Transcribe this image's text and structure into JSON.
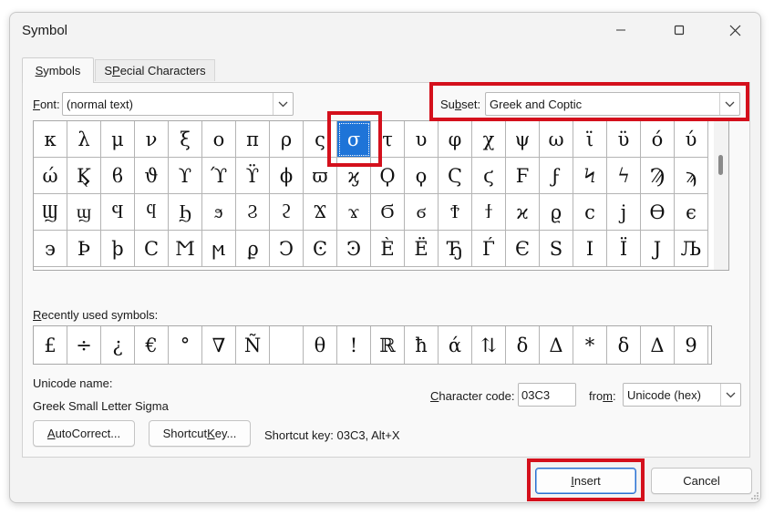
{
  "window": {
    "title": "Symbol"
  },
  "tabs": [
    {
      "label": "Symbols",
      "accel": "S",
      "rest": "ymbols"
    },
    {
      "label": "Special Characters",
      "accel": "P",
      "pre": "S",
      "rest": "ecial Characters"
    }
  ],
  "font": {
    "accel": "F",
    "rest": "ont:",
    "value": "(normal text)"
  },
  "subset": {
    "pre": "Su",
    "accel": "b",
    "rest": "set:",
    "value": "Greek and Coptic"
  },
  "symbol_grid": {
    "selected": "σ",
    "cells": [
      "κ",
      "λ",
      "μ",
      "ν",
      "ξ",
      "ο",
      "π",
      "ρ",
      "ς",
      "σ",
      "τ",
      "υ",
      "φ",
      "χ",
      "ψ",
      "ω",
      "ϊ",
      "ϋ",
      "ό",
      "ύ",
      "ώ",
      "Ϗ",
      "ϐ",
      "ϑ",
      "ϒ",
      "ϓ",
      "ϔ",
      "ϕ",
      "ϖ",
      "ϗ",
      "Ϙ",
      "ϙ",
      "Ϛ",
      "ϛ",
      "Ϝ",
      "ϝ",
      "Ϟ",
      "ϟ",
      "Ϡ",
      "ϡ",
      "Ϣ",
      "ϣ",
      "Ϥ",
      "ϥ",
      "Ϧ",
      "ϧ",
      "Ϩ",
      "ϩ",
      "Ϫ",
      "ϫ",
      "Ϭ",
      "ϭ",
      "Ϯ",
      "ϯ",
      "ϰ",
      "ϱ",
      "ϲ",
      "ϳ",
      "ϴ",
      "ϵ",
      "϶",
      "Ϸ",
      "ϸ",
      "Ϲ",
      "Ϻ",
      "ϻ",
      "ϼ",
      "Ͻ",
      "Ͼ",
      "Ͽ",
      "Ѐ",
      "Ё",
      "Ђ",
      "Ѓ",
      "Є",
      "Ѕ",
      "І",
      "Ї",
      "Ј",
      "Љ"
    ]
  },
  "recent": {
    "label_accel": "R",
    "label_rest": "ecently used symbols:",
    "symbols": [
      "£",
      "÷",
      "¿",
      "€",
      "°",
      "∇",
      "Ñ",
      " ",
      "θ",
      "!",
      "ℝ",
      "ħ",
      "ά",
      "⇅",
      "δ",
      "Δ",
      "*",
      "δ",
      "Δ",
      "9"
    ]
  },
  "unicode_name": {
    "label": "Unicode name:",
    "value": "Greek Small Letter Sigma"
  },
  "character_code": {
    "accel": "C",
    "rest": "haracter code:",
    "value": "03C3"
  },
  "from": {
    "pre": "fro",
    "accel": "m",
    "rest": ":",
    "value": "Unicode (hex)"
  },
  "buttons": {
    "autocorrect": {
      "accel": "A",
      "rest": "utoCorrect..."
    },
    "shortcut_key": {
      "pre": "Shortcut ",
      "accel": "K",
      "rest": "ey..."
    },
    "insert": {
      "accel": "I",
      "rest": "nsert"
    },
    "cancel": "Cancel"
  },
  "shortcut_info": "Shortcut key: 03C3, Alt+X",
  "icons": {
    "minimize": "minimize-icon",
    "maximize": "maximize-icon",
    "close": "close-icon",
    "dropdown": "chevron-down-icon",
    "grip": "resize-grip-icon"
  },
  "colors": {
    "selection": "#1e74d8",
    "highlight": "#d4101c",
    "default_button_border": "#2a6fcf"
  }
}
